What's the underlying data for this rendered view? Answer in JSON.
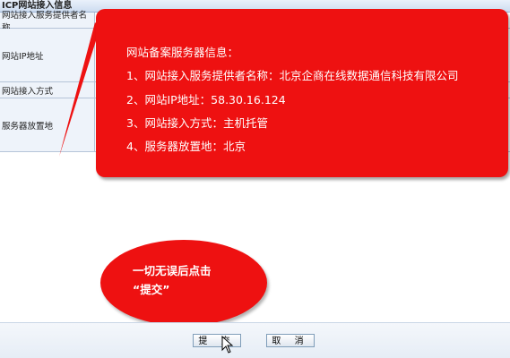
{
  "form": {
    "header": "ICP网站接入信息",
    "fields": [
      {
        "label": "网站接入服务提供者名称"
      },
      {
        "label": "网站IP地址"
      },
      {
        "label": "网站接入方式"
      },
      {
        "label": "服务器放置地"
      }
    ]
  },
  "callout": {
    "title": "网站备案服务器信息：",
    "lines": [
      "1、网站接入服务提供者名称：北京企商在线数据通信科技有限公司",
      "2、网站IP地址：58.30.16.124",
      "3、网站接入方式：主机托管",
      "4、服务器放置地：北京"
    ],
    "color": "#ee1111"
  },
  "hint": {
    "line1": "一切无误后点击",
    "line2": "“提交”"
  },
  "buttons": {
    "submit": "提 交",
    "cancel": "取 消"
  }
}
